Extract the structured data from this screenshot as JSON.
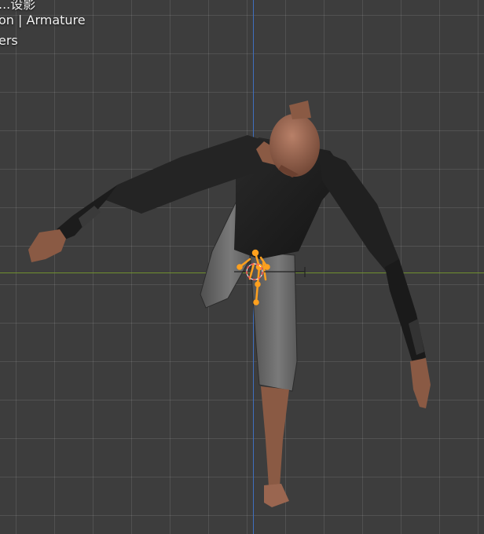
{
  "viewport_overlay": {
    "line1": "...设影",
    "line2": "on | Armature",
    "line3": "ers"
  },
  "colors": {
    "background": "#3d3d3d",
    "axis_z": "#3f6fbf",
    "axis_x": "#6f8f2f",
    "armature_selected": "#ffa01e",
    "skin": "#8a5a44",
    "shirt": "#202020",
    "pants": "#6a6a6a"
  },
  "icons": {
    "armature": "armature-bones-icon",
    "origin": "object-origin-icon"
  }
}
